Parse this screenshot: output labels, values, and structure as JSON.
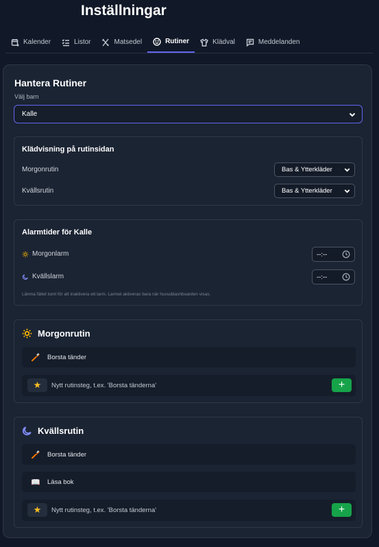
{
  "page": {
    "title": "Inställningar"
  },
  "tabs": [
    {
      "label": "Kalender",
      "icon": "calendar-plus-icon"
    },
    {
      "label": "Listor",
      "icon": "list-check-icon"
    },
    {
      "label": "Matsedel",
      "icon": "utensils-icon"
    },
    {
      "label": "Rutiner",
      "icon": "smile-icon",
      "active": true
    },
    {
      "label": "Klädval",
      "icon": "shirt-icon"
    },
    {
      "label": "Meddelanden",
      "icon": "message-icon"
    }
  ],
  "routines": {
    "title": "Hantera Rutiner",
    "child_label": "Välj barn",
    "child_selected": "Kalle"
  },
  "clothing": {
    "title": "Klädvisning på rutinsidan",
    "morning_label": "Morgonrutin",
    "morning_value": "Bas & Ytterkläder",
    "evening_label": "Kvällsrutin",
    "evening_value": "Bas & Ytterkläder"
  },
  "alarms": {
    "title": "Alarmtider för Kalle",
    "morning_label": "Morgonlarm",
    "morning_value": "--:--",
    "evening_label": "Kvällslarm",
    "evening_value": "--:--",
    "hint": "Lämna fältet tomt för att inaktivera ett larm. Larmet aktiveras bara när huvuddashboarden visas."
  },
  "morning_routine": {
    "title": "Morgonrutin",
    "steps": [
      {
        "emoji": "🪥",
        "label": "Borsta tänder"
      }
    ],
    "new_placeholder": "Nytt rutinsteg, t.ex. 'Borsta tänderna'",
    "star": "★",
    "add": "+"
  },
  "evening_routine": {
    "title": "Kvällsrutin",
    "steps": [
      {
        "emoji": "🪥",
        "label": "Borsta tänder"
      },
      {
        "emoji": "📖",
        "label": "Läsa bok"
      }
    ],
    "new_placeholder": "Nytt rutinsteg, t.ex. 'Borsta tänderna'",
    "star": "★",
    "add": "+"
  },
  "colors": {
    "background": "#111827",
    "card": "#1b2433",
    "accent": "#6366f1",
    "add_button": "#16a34a",
    "sun": "#f5b400",
    "moon": "#818cf8"
  }
}
